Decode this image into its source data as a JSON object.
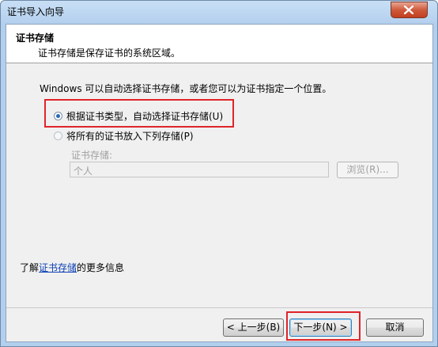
{
  "window": {
    "title": "证书导入向导"
  },
  "header": {
    "title": "证书存储",
    "description": "证书存储是保存证书的系统区域。"
  },
  "body": {
    "intro": "Windows 可以自动选择证书存储，或者您可以为证书指定一个位置。",
    "option_auto": {
      "label": "根据证书类型，自动选择证书存储(U)",
      "checked": true
    },
    "option_manual": {
      "label": "将所有的证书放入下列存储(P)",
      "checked": false
    },
    "store_label": "证书存储:",
    "store_value": "个人",
    "browse_label": "浏览(R)..."
  },
  "more_info": {
    "prefix": "了解",
    "link": "证书存储",
    "suffix": "的更多信息"
  },
  "buttons": {
    "back": "< 上一步(B)",
    "next": "下一步(N) >",
    "cancel": "取消"
  }
}
